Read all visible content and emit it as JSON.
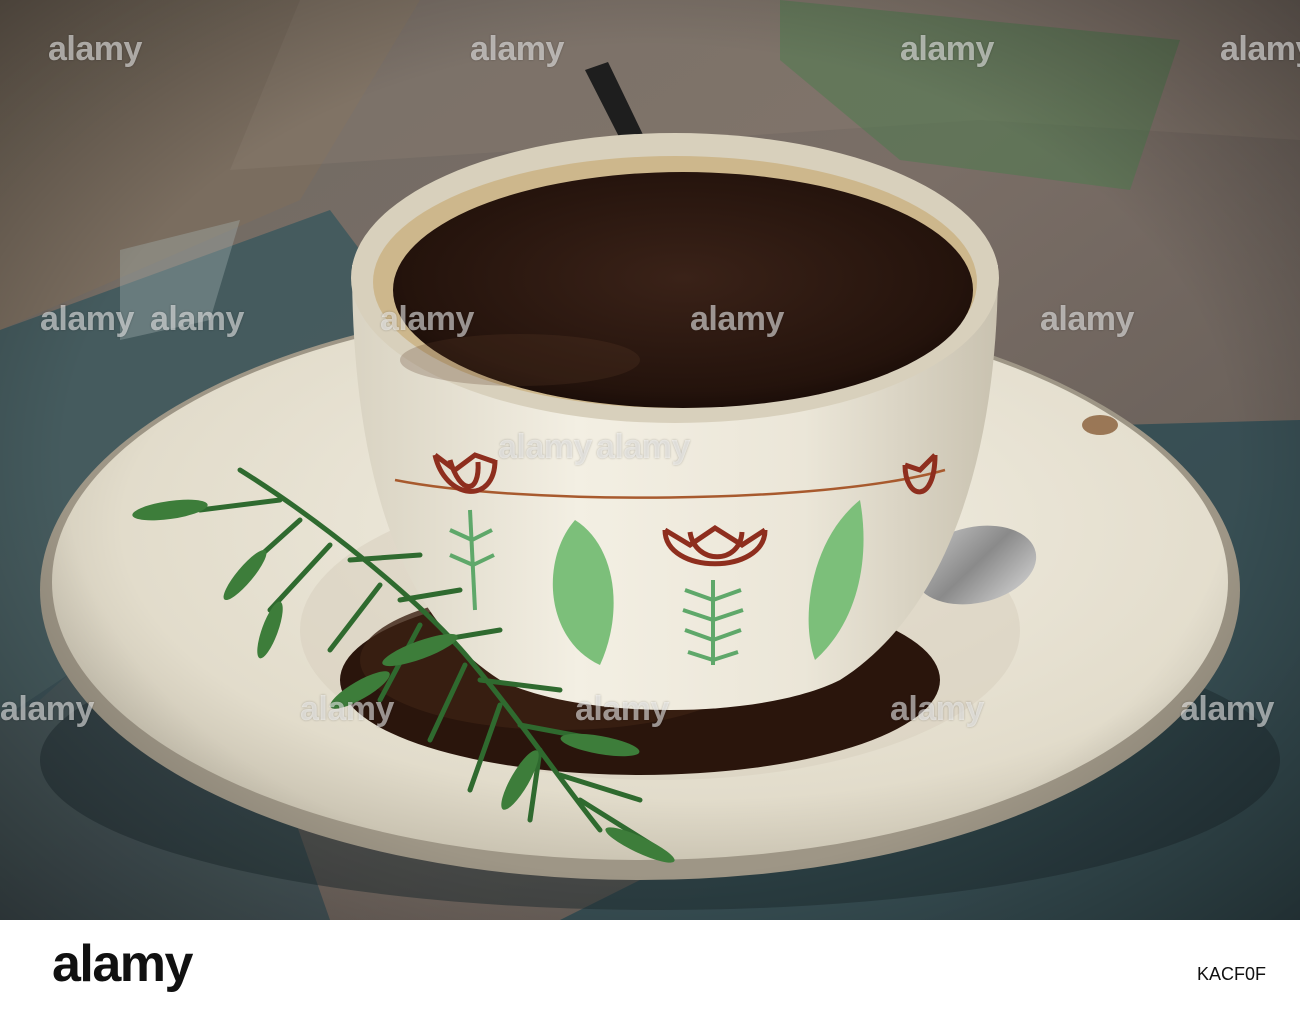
{
  "watermark": {
    "text": "alamy"
  },
  "footer": {
    "logo": "alamy",
    "image_id": "KACF0F"
  }
}
